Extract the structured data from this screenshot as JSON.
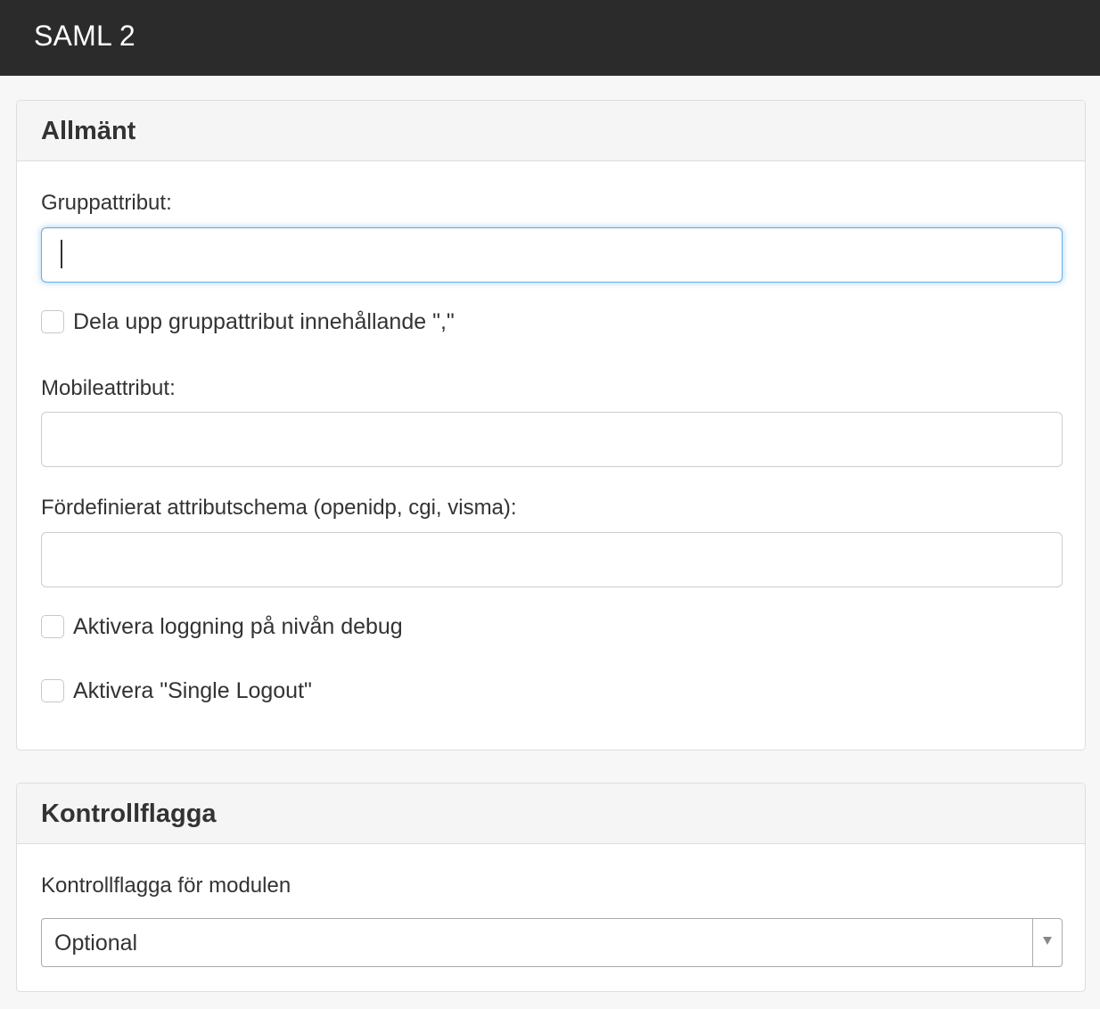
{
  "header": {
    "title": "SAML 2"
  },
  "general_panel": {
    "title": "Allmänt",
    "group_attribute": {
      "label": "Gruppattribut:",
      "value": ""
    },
    "split_group_attribute": {
      "label": "Dela upp gruppattribut innehållande \",\"",
      "checked": false
    },
    "mobile_attribute": {
      "label": "Mobileattribut:",
      "value": ""
    },
    "predefined_schema": {
      "label": "Fördefinierat attributschema (openidp, cgi, visma):",
      "value": ""
    },
    "debug_logging": {
      "label": "Aktivera loggning på nivån debug",
      "checked": false
    },
    "single_logout": {
      "label": "Aktivera \"Single Logout\"",
      "checked": false
    }
  },
  "control_flag_panel": {
    "title": "Kontrollflagga",
    "control_flag": {
      "label": "Kontrollflagga för modulen",
      "selected": "Optional"
    }
  },
  "colors": {
    "topbar": "#2b2b2b",
    "page_background": "#f7f7f7",
    "focus_border": "#66afe9"
  }
}
